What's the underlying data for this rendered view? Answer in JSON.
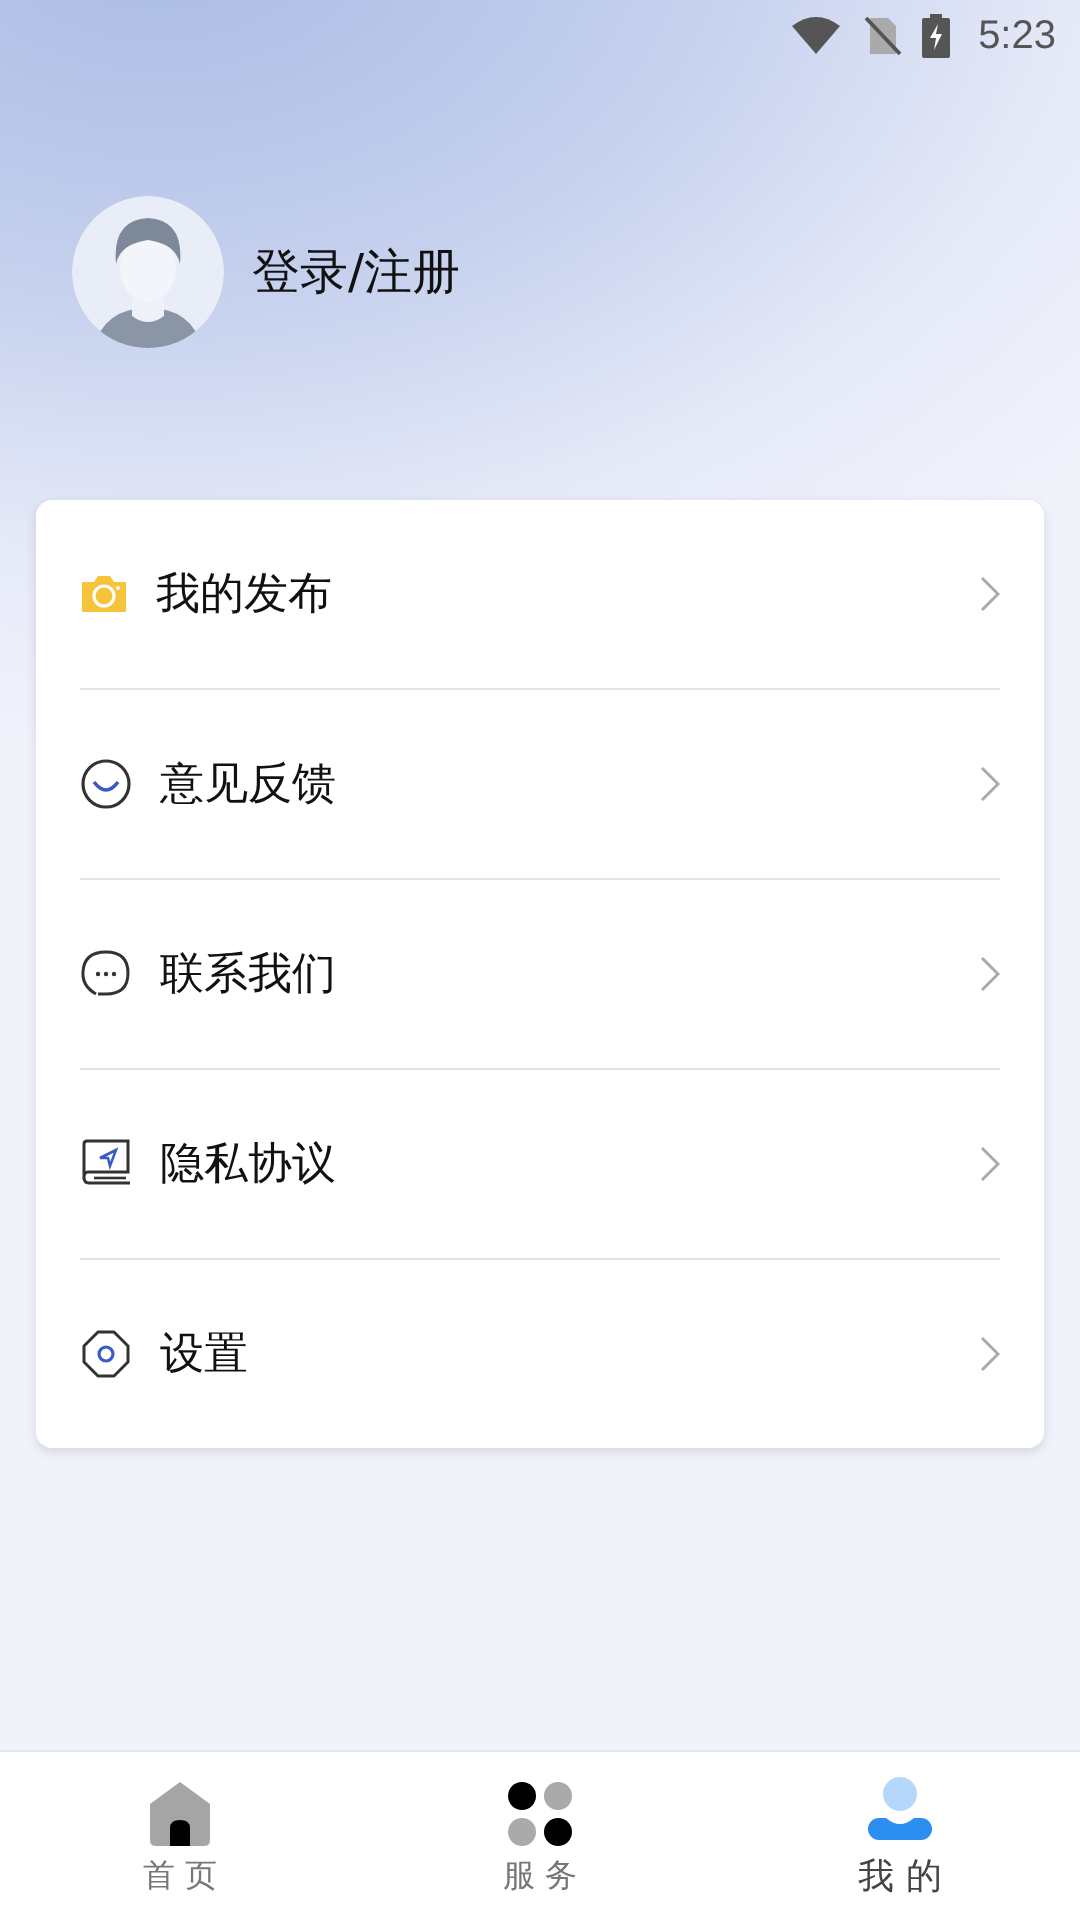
{
  "status_bar": {
    "time": "5:23"
  },
  "profile": {
    "login_label": "登录/注册"
  },
  "menu": [
    {
      "kind": "camera",
      "label": "我的发布"
    },
    {
      "kind": "smile",
      "label": "意见反馈"
    },
    {
      "kind": "chat",
      "label": "联系我们"
    },
    {
      "kind": "book",
      "label": "隐私协议"
    },
    {
      "kind": "gear",
      "label": "设置"
    }
  ],
  "tabs": [
    {
      "kind": "home",
      "label": "首 页",
      "selected": false
    },
    {
      "kind": "services",
      "label": "服 务",
      "selected": false
    },
    {
      "kind": "me",
      "label": "我 的",
      "selected": true
    }
  ]
}
